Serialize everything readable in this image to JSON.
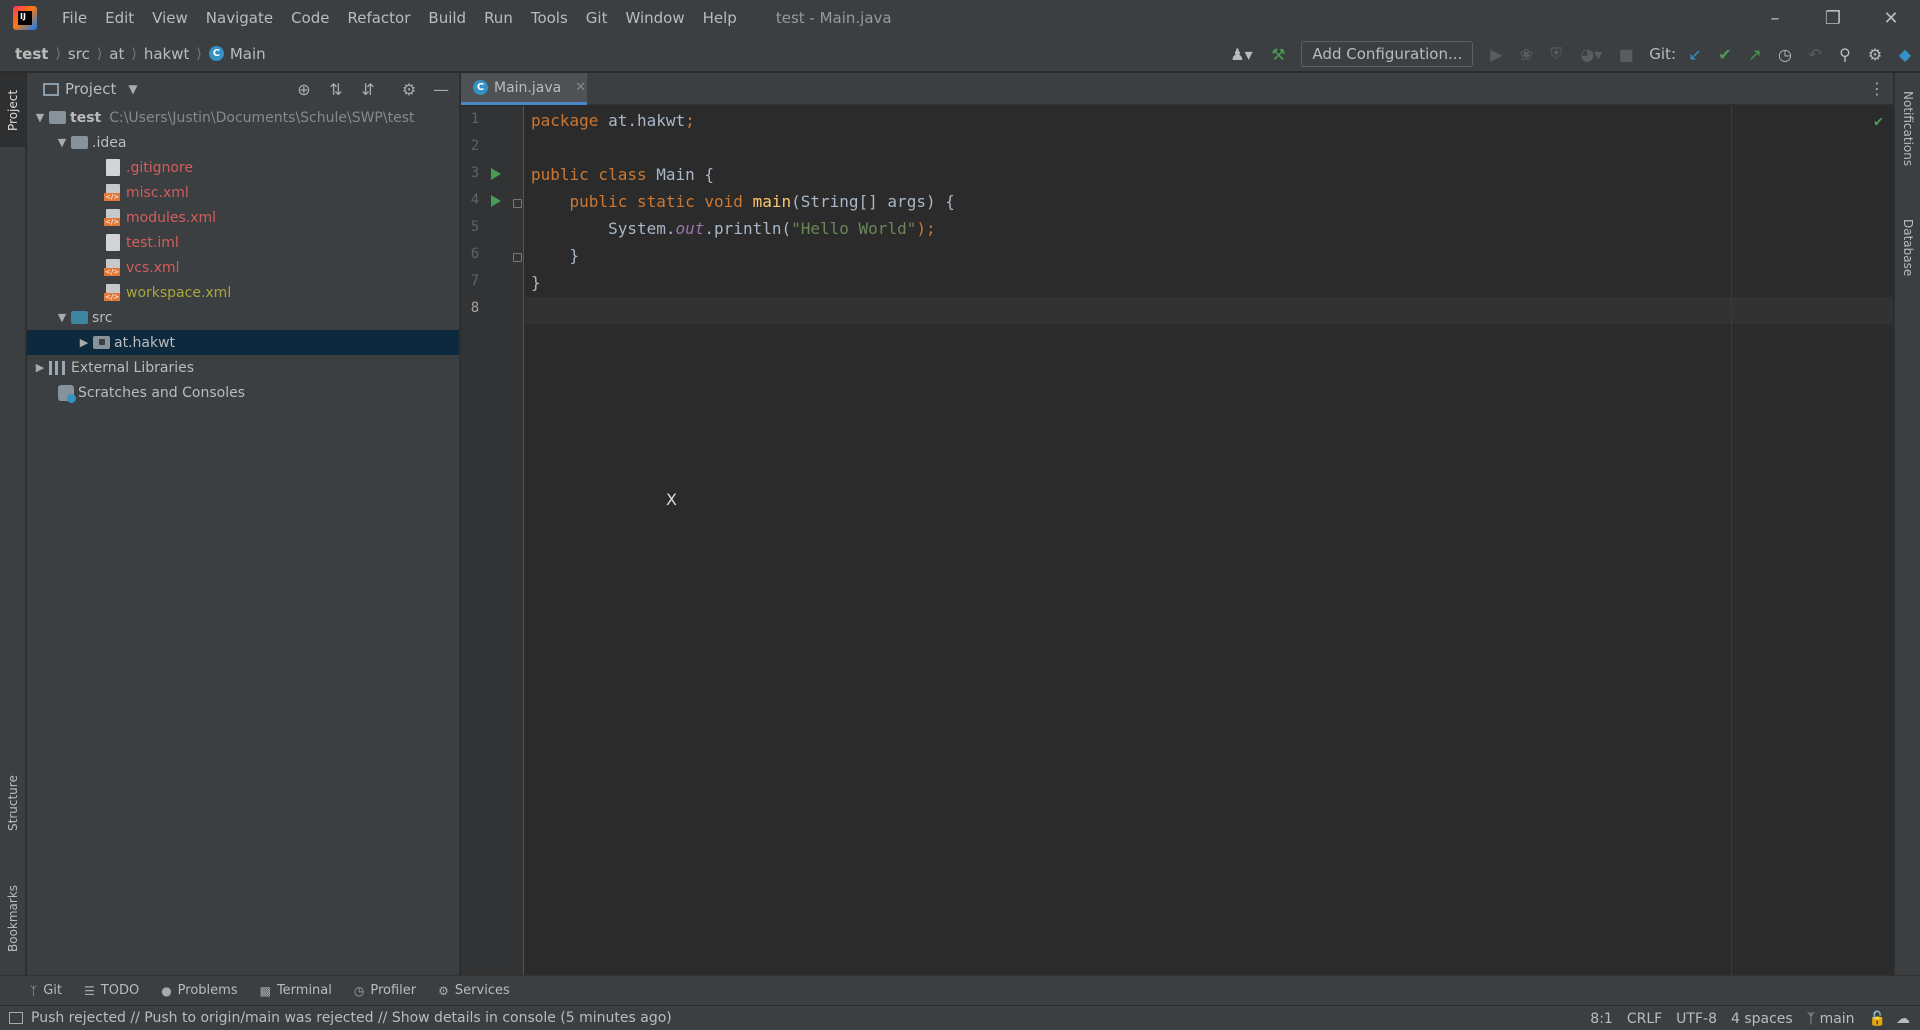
{
  "menu": {
    "items": [
      "File",
      "Edit",
      "View",
      "Navigate",
      "Code",
      "Refactor",
      "Build",
      "Run",
      "Tools",
      "Git",
      "Window",
      "Help"
    ],
    "window_title": "test - Main.java"
  },
  "breadcrumb": {
    "items": [
      "test",
      "src",
      "at",
      "hakwt",
      "Main"
    ]
  },
  "toolbar": {
    "add_config_label": "Add Configuration...",
    "git_label": "Git:"
  },
  "project_panel": {
    "title": "Project",
    "tree": {
      "root_name": "test",
      "root_path": "C:\\Users\\Justin\\Documents\\Schule\\SWP\\test",
      "idea_folder": ".idea",
      "idea_files": [
        ".gitignore",
        "misc.xml",
        "modules.xml",
        "test.iml",
        "vcs.xml",
        "workspace.xml"
      ],
      "src_folder": "src",
      "package": "at.hakwt",
      "external_libraries": "External Libraries",
      "scratches": "Scratches and Consoles"
    }
  },
  "left_stripe": {
    "project": "Project",
    "structure": "Structure",
    "bookmarks": "Bookmarks"
  },
  "right_stripe": {
    "notifications": "Notifications",
    "database": "Database"
  },
  "editor": {
    "tab_label": "Main.java",
    "line_numbers": [
      "1",
      "2",
      "3",
      "4",
      "5",
      "6",
      "7",
      "8"
    ],
    "code": {
      "line1_kw": "package",
      "line1_rest": " at.hakwt",
      "line3_kw": "public class",
      "line3_rest": " Main {",
      "line4_kw": "public static void",
      "line4_fn": "main",
      "line4_rest": "(String[] args) {",
      "line5_a": "System.",
      "line5_field": "out",
      "line5_b": ".println(",
      "line5_str": "\"Hello World\"",
      "line5_c": ");",
      "line6": "}",
      "line7": "}"
    }
  },
  "bottom_tools": [
    "Git",
    "TODO",
    "Problems",
    "Terminal",
    "Profiler",
    "Services"
  ],
  "status": {
    "message": "Push rejected // Push to origin/main was rejected // Show details in console (5 minutes ago)",
    "position": "8:1",
    "line_sep": "CRLF",
    "encoding": "UTF-8",
    "indent": "4 spaces",
    "branch": "main"
  },
  "colors": {
    "keyword": "#cc7832",
    "function": "#ffc66d",
    "string": "#6a8759",
    "field": "#9876aa",
    "ignored_file": "#d35d5d",
    "modified_file": "#a8a639",
    "selection": "#0d293e"
  }
}
